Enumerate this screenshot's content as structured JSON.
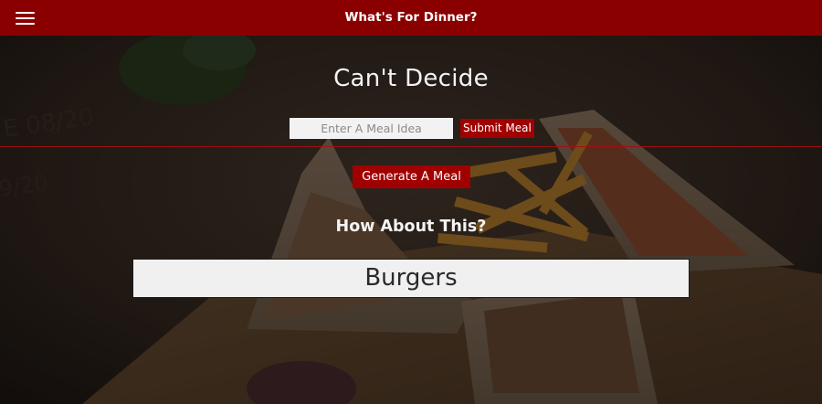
{
  "header": {
    "title": "What's For Dinner?",
    "menu_icon": "hamburger-menu-icon",
    "background_color": "#8a0000"
  },
  "main": {
    "heading": "Can't Decide",
    "meal_input": {
      "value": "",
      "placeholder": "Enter A Meal Idea"
    },
    "submit_label": "Submit Meal",
    "generate_label": "Generate A Meal",
    "subheading": "How About This?",
    "result": "Burgers"
  },
  "colors": {
    "accent": "#a00000",
    "text_light": "#f4f4f4",
    "result_background": "#f0f0f0"
  }
}
